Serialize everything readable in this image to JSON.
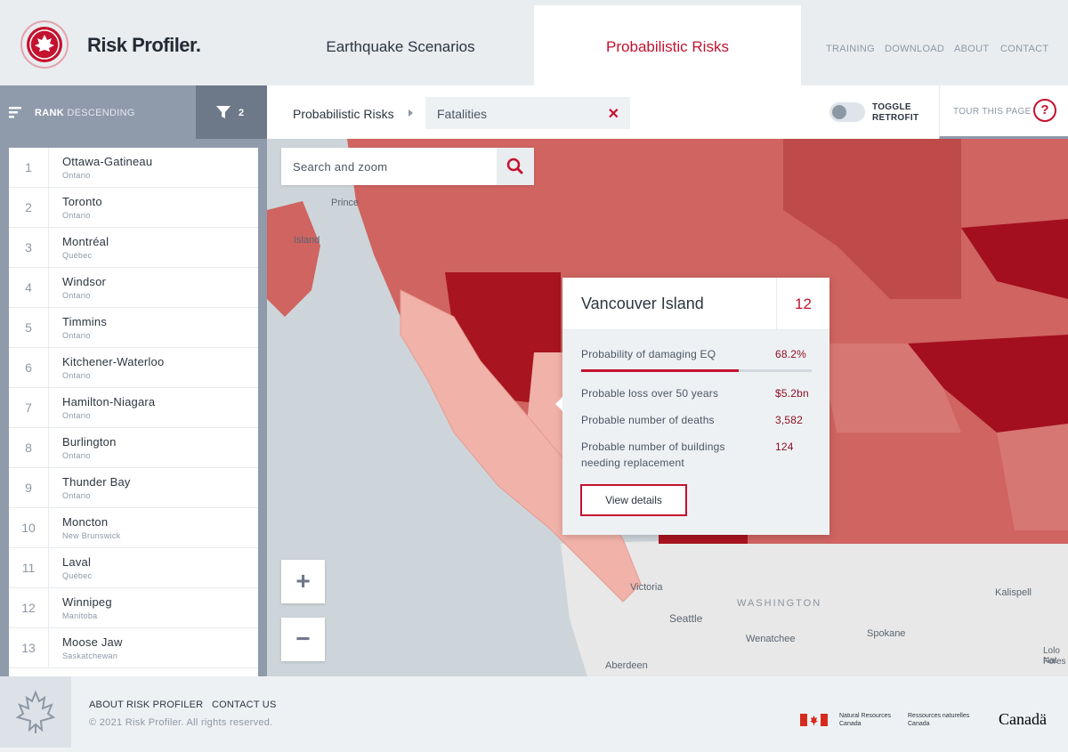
{
  "brand": {
    "name": "Risk Profiler."
  },
  "tabs": [
    {
      "label": "Earthquake Scenarios"
    },
    {
      "label": "Probabilistic Risks"
    }
  ],
  "topnav": [
    "TRAINING",
    "DOWNLOAD",
    "ABOUT",
    "CONTACT"
  ],
  "rank": {
    "bold": "RANK",
    "rest": "DESCENDING",
    "filter_count": "2"
  },
  "breadcrumb": {
    "label": "Probabilistic Risks",
    "filter_value": "Fatalities",
    "clear": "✕"
  },
  "toggle": {
    "line1": "TOGGLE",
    "line2": "RETROFIT"
  },
  "tour": {
    "label": "TOUR THIS PAGE",
    "help": "?"
  },
  "list": [
    {
      "rank": "1",
      "city": "Ottawa-Gatineau",
      "province": "Ontario"
    },
    {
      "rank": "2",
      "city": "Toronto",
      "province": "Ontario"
    },
    {
      "rank": "3",
      "city": "Montréal",
      "province": "Québec"
    },
    {
      "rank": "4",
      "city": "Windsor",
      "province": "Ontario"
    },
    {
      "rank": "5",
      "city": "Timmins",
      "province": "Ontario"
    },
    {
      "rank": "6",
      "city": "Kitchener-Waterloo",
      "province": "Ontario"
    },
    {
      "rank": "7",
      "city": "Hamilton-Niagara",
      "province": "Ontario"
    },
    {
      "rank": "8",
      "city": "Burlington",
      "province": "Ontario"
    },
    {
      "rank": "9",
      "city": "Thunder Bay",
      "province": "Ontario"
    },
    {
      "rank": "10",
      "city": "Moncton",
      "province": "New Brunswick"
    },
    {
      "rank": "11",
      "city": "Laval",
      "province": "Québec"
    },
    {
      "rank": "12",
      "city": "Winnipeg",
      "province": "Manitoba"
    },
    {
      "rank": "13",
      "city": "Moose Jaw",
      "province": "Saskatchewan"
    }
  ],
  "search": {
    "placeholder": "Search and zoom"
  },
  "zoom": {
    "in": "+",
    "out": "−"
  },
  "popup": {
    "title": "Vancouver Island",
    "rank": "12",
    "stats": [
      {
        "label": "Probability of damaging EQ",
        "value": "68.2%"
      },
      {
        "label": "Probable loss over 50 years",
        "value": "$5.2bn"
      },
      {
        "label": "Probable number of deaths",
        "value": "3,582"
      },
      {
        "label": "Probable number of buildings needing replacement",
        "value": "124"
      }
    ],
    "probability_fraction": 0.682,
    "button": "View details"
  },
  "map_labels": [
    "Prince",
    "Island",
    "Victoria",
    "Seattle",
    "WASHINGTON",
    "Wenatchee",
    "Spokane",
    "Kalispell",
    "Aberdeen",
    "Lolo Nat",
    "Fores"
  ],
  "footer": {
    "links": [
      "ABOUT RISK PROFILER",
      "CONTACT US"
    ],
    "copyright": "© 2021 Risk Profiler. All rights reserved.",
    "gov_en": [
      "Natural Resources",
      "Canada"
    ],
    "gov_fr": [
      "Ressources naturelles",
      "Canada"
    ],
    "wordmark": "Canadä"
  },
  "colors": {
    "accent": "#c4122f",
    "sidebar": "#8f9aab",
    "filter": "#6d7889"
  }
}
